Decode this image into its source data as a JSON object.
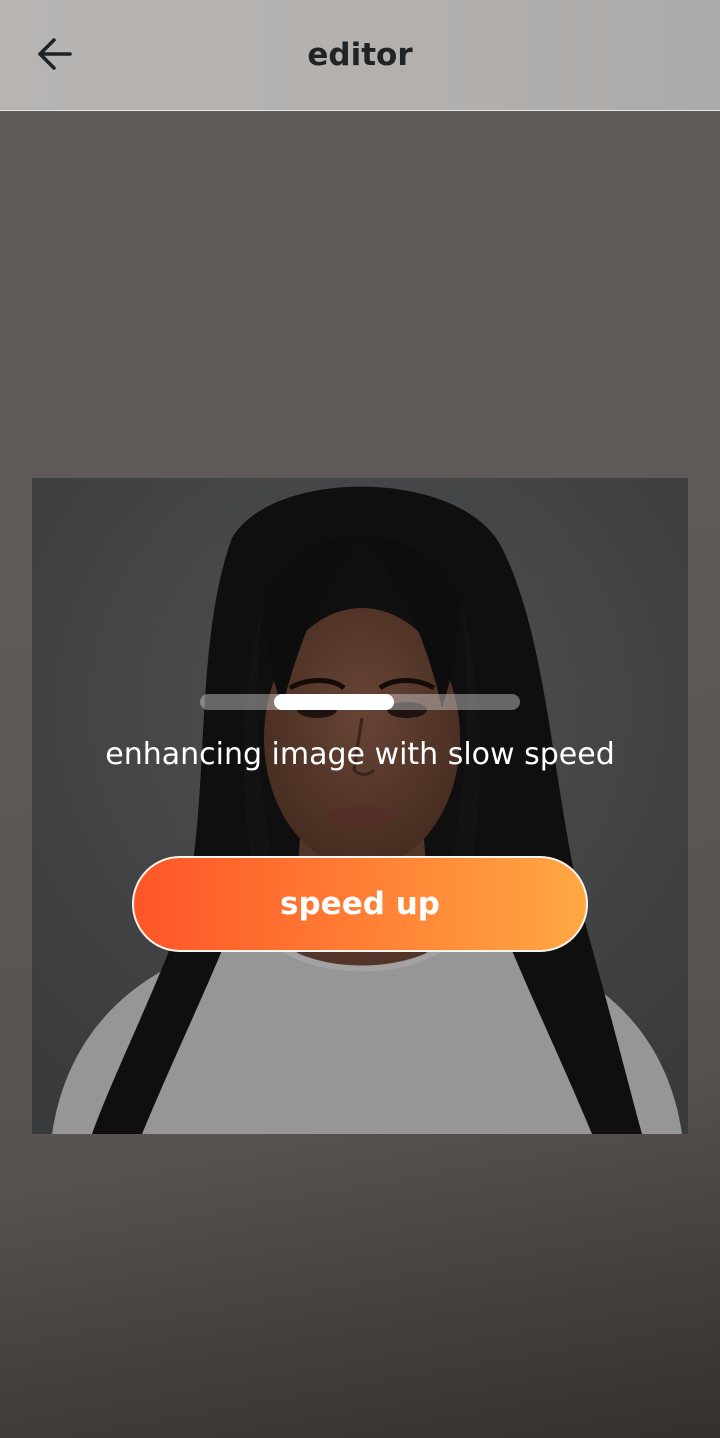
{
  "header": {
    "title": "editor",
    "back_icon": "arrow-left-icon"
  },
  "enhance": {
    "status_text": "enhancing image with slow speed",
    "progress": 0.375,
    "speed_up_label": "speed up"
  },
  "colors": {
    "button_gradient_start": "#ff5528",
    "button_gradient_end": "#ffa843",
    "progress_fill": "#ffffff"
  }
}
